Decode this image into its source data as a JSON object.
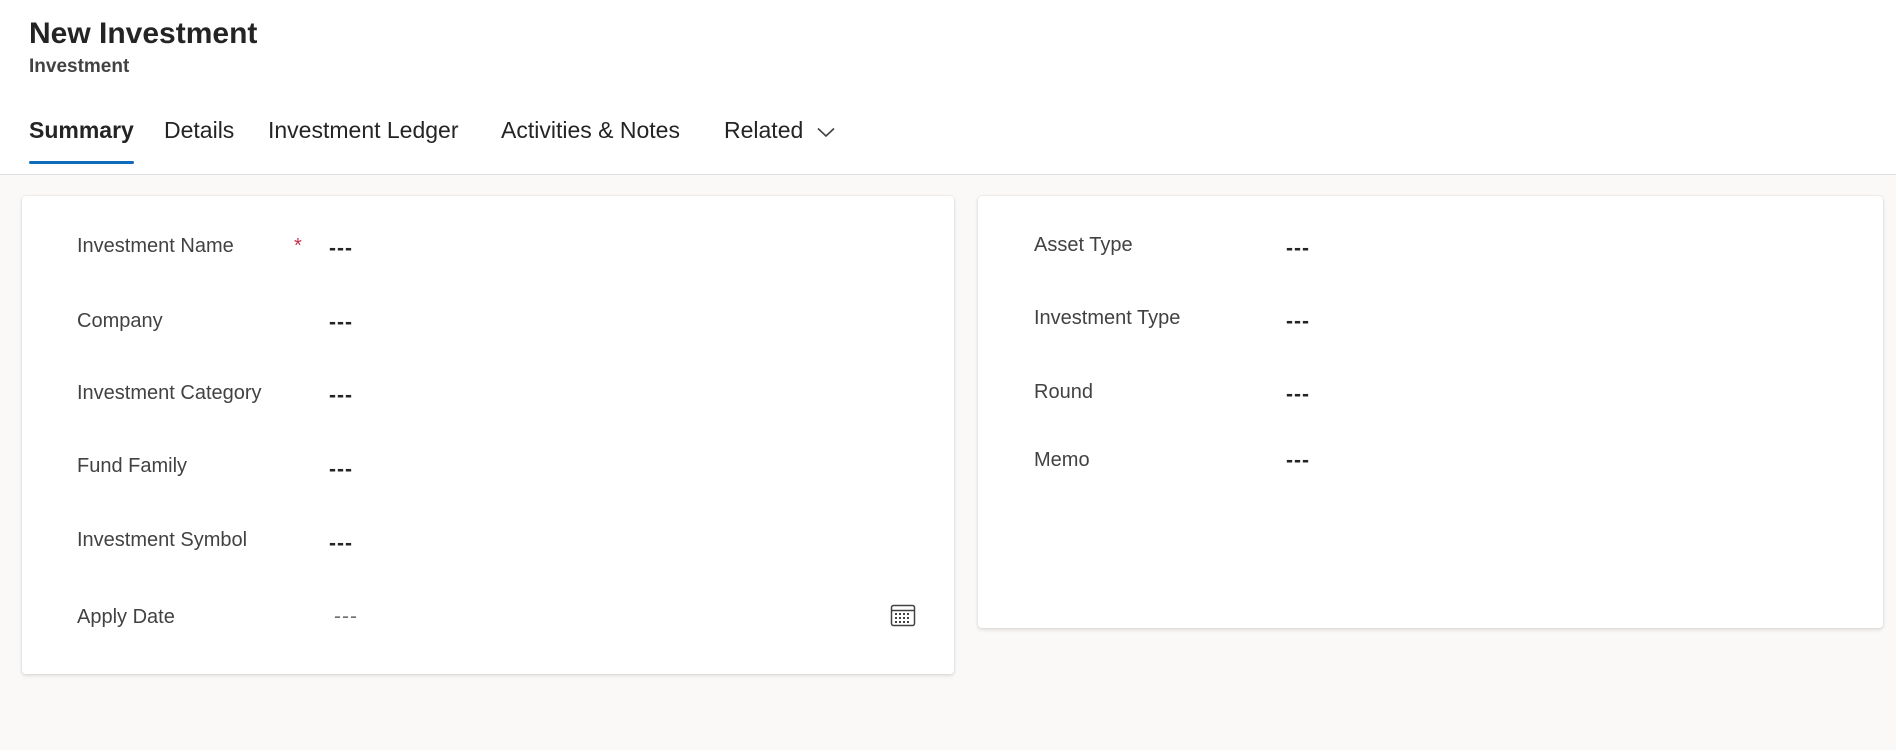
{
  "header": {
    "title": "New Investment",
    "subtitle": "Investment"
  },
  "tabs": [
    {
      "label": "Summary",
      "selected": true
    },
    {
      "label": "Details"
    },
    {
      "label": "Investment Ledger"
    },
    {
      "label": "Activities & Notes"
    },
    {
      "label": "Related",
      "icon": "chevron-down-icon"
    }
  ],
  "left_card": {
    "fields": [
      {
        "label": "Investment Name",
        "value": "---",
        "required": true
      },
      {
        "label": "Company",
        "value": "---"
      },
      {
        "label": "Investment Category",
        "value": "---"
      },
      {
        "label": "Fund Family",
        "value": "---"
      },
      {
        "label": "Investment Symbol",
        "value": "---"
      },
      {
        "label": "Apply Date",
        "placeholder": "---",
        "icon": "calendar-icon"
      }
    ],
    "required_marker": "*"
  },
  "right_card": {
    "fields": [
      {
        "label": "Asset Type",
        "value": "---"
      },
      {
        "label": "Investment Type",
        "value": "---"
      },
      {
        "label": "Round",
        "value": "---"
      },
      {
        "label": "Memo",
        "value": "---"
      }
    ]
  },
  "colors": {
    "accent": "#0f6cbd",
    "required": "#c4314b",
    "page_background": "#faf9f8",
    "card_background": "#ffffff"
  }
}
